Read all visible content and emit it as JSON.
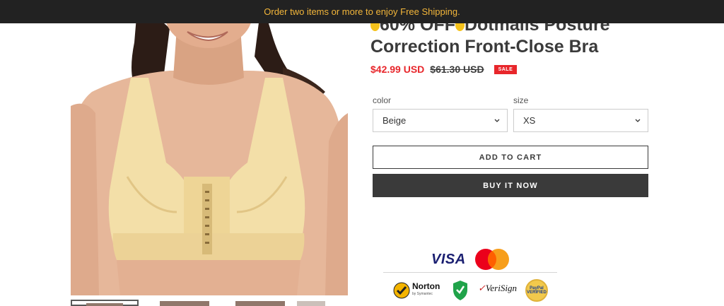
{
  "announcement": {
    "text": "Order two items or more to enjoy Free Shipping."
  },
  "product": {
    "title_line1": "60% OFF",
    "title_brand": "Dotmalls Posture",
    "title_line2": "Correction Front-Close Bra",
    "price_sale": "$42.99 USD",
    "price_old": "$61.30 USD",
    "badge": "SALE"
  },
  "options": {
    "color": {
      "label": "color",
      "value": "Beige"
    },
    "size": {
      "label": "size",
      "value": "XS"
    }
  },
  "buttons": {
    "add_to_cart": "ADD TO CART",
    "buy_now": "BUY IT NOW"
  },
  "payment": {
    "visa": "VISA",
    "norton": "Norton",
    "norton_sub": "by Symantec",
    "verisign_a": "Veri",
    "verisign_b": "Sign",
    "paypal": "PayPal VERIFIED"
  },
  "colors": {
    "accent_sale": "#e8262b",
    "dark": "#3a3a3a",
    "announcement_bg": "#222222",
    "announcement_text": "#f3b63a"
  }
}
